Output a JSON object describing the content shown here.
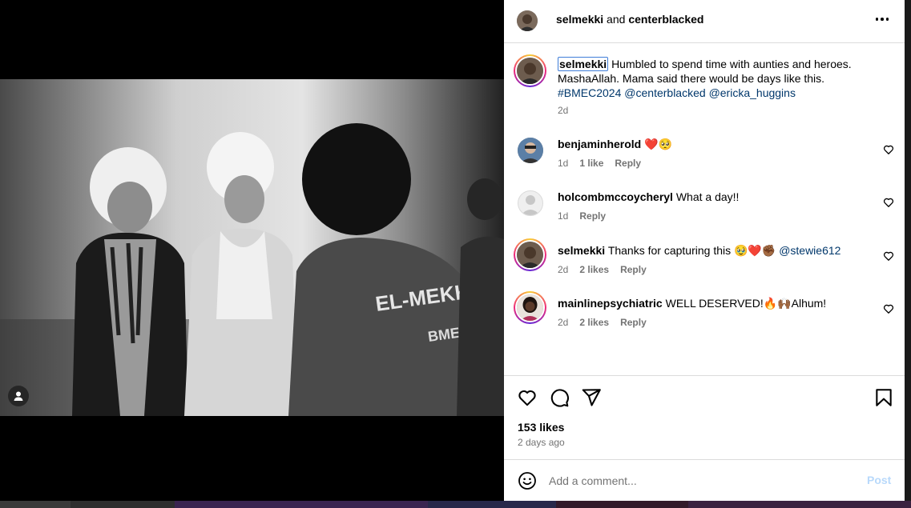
{
  "post": {
    "header": {
      "username": "selmekki",
      "joiner": " and ",
      "collaborator": "centerblacked"
    },
    "caption": {
      "username": "selmekki",
      "text": "Humbled to spend time with aunties and heroes. MashaAllah. Mama said there would be days like this.",
      "hashtag": "#BMEC2024",
      "mention1": "@centerblacked",
      "mention2": "@ericka_huggins",
      "time": "2d"
    },
    "photo": {
      "shirt_text": "EL-MEKKI",
      "logo_text": "BMEC"
    },
    "comments": [
      {
        "username": "benjaminherold",
        "text": "❤️🥺",
        "time": "1d",
        "likes": "1 like",
        "reply": "Reply"
      },
      {
        "username": "holcombmccoycheryl",
        "text": "What a day!!",
        "time": "1d",
        "likes": "",
        "reply": "Reply"
      },
      {
        "username": "selmekki",
        "text": "Thanks for capturing this 🥹❤️✊🏾",
        "mention": "@stewie612",
        "time": "2d",
        "likes": "2 likes",
        "reply": "Reply"
      },
      {
        "username": "mainlinepsychiatric",
        "text": "WELL DESERVED!🔥🙌🏾Alhum!",
        "time": "2d",
        "likes": "2 likes",
        "reply": "Reply"
      }
    ],
    "likes_count": "153 likes",
    "posted_ago": "2 days ago",
    "add_comment": {
      "placeholder": "Add a comment...",
      "post_label": "Post"
    }
  },
  "icons": {
    "more": "more-options-icon",
    "like": "heart-icon",
    "comment": "comment-icon",
    "share": "share-icon",
    "save": "bookmark-icon",
    "emoji": "emoji-icon",
    "tag": "user-tag-icon"
  },
  "colors": {
    "link": "#00376b",
    "muted": "#737373",
    "post_disabled": "#b8d9fb",
    "divider": "#dbdbdb"
  }
}
